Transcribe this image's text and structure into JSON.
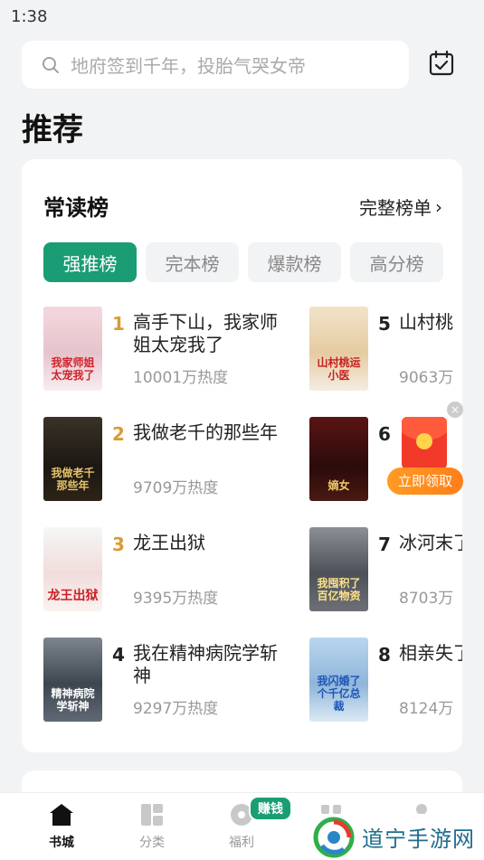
{
  "status_bar": {
    "time": "1:38"
  },
  "search": {
    "placeholder": "地府签到千年，投胎气哭女帝"
  },
  "page_title": "推荐",
  "ranking": {
    "title": "常读榜",
    "full_list_label": "完整榜单",
    "tabs": [
      {
        "label": "强推榜",
        "active": true
      },
      {
        "label": "完本榜",
        "active": false
      },
      {
        "label": "爆款榜",
        "active": false
      },
      {
        "label": "高分榜",
        "active": false
      }
    ],
    "books": [
      {
        "rank": "1",
        "title": "高手下山，我家师姐太宠我了",
        "heat": "10001万热度",
        "cover_text": "我家师姐太宠我了"
      },
      {
        "rank": "2",
        "title": "我做老千的那些年",
        "heat": "9709万热度",
        "cover_text": "我做老千那些年"
      },
      {
        "rank": "3",
        "title": "龙王出狱",
        "heat": "9395万热度",
        "cover_text": "龙王出狱"
      },
      {
        "rank": "4",
        "title": "我在精神病院学斩神",
        "heat": "9297万热度",
        "cover_text": "精神病院学斩神"
      },
      {
        "rank": "5",
        "title": "山村桃",
        "heat": "9063万",
        "cover_text": "山村桃运小医"
      },
      {
        "rank": "6",
        "title": "",
        "heat": "",
        "cover_text": "嫡女"
      },
      {
        "rank": "7",
        "title": "冰河末了百亿",
        "heat": "8703万",
        "cover_text": "我囤积了百亿物资"
      },
      {
        "rank": "8",
        "title": "相亲失了个千",
        "heat": "8124万",
        "cover_text": "我闪婚了个千亿总裁"
      }
    ]
  },
  "red_packet": {
    "button_label": "立即领取",
    "close_label": "×"
  },
  "bottom_nav": {
    "items": [
      {
        "label": "书城",
        "icon": "house-icon",
        "active": true
      },
      {
        "label": "分类",
        "icon": "category-icon",
        "active": false
      },
      {
        "label": "福利",
        "icon": "gift-icon",
        "active": false
      },
      {
        "label": "",
        "icon": "bookshelf-icon",
        "active": false
      },
      {
        "label": "",
        "icon": "profile-icon",
        "active": false
      }
    ],
    "earn_badge": "赚钱"
  },
  "watermark": {
    "text": "道宁手游网"
  },
  "colors": {
    "accent": "#1a9d74",
    "rank_gold": "#d99b35",
    "red_packet": "#f23a2b",
    "claim_button": "#ff8c1f"
  }
}
